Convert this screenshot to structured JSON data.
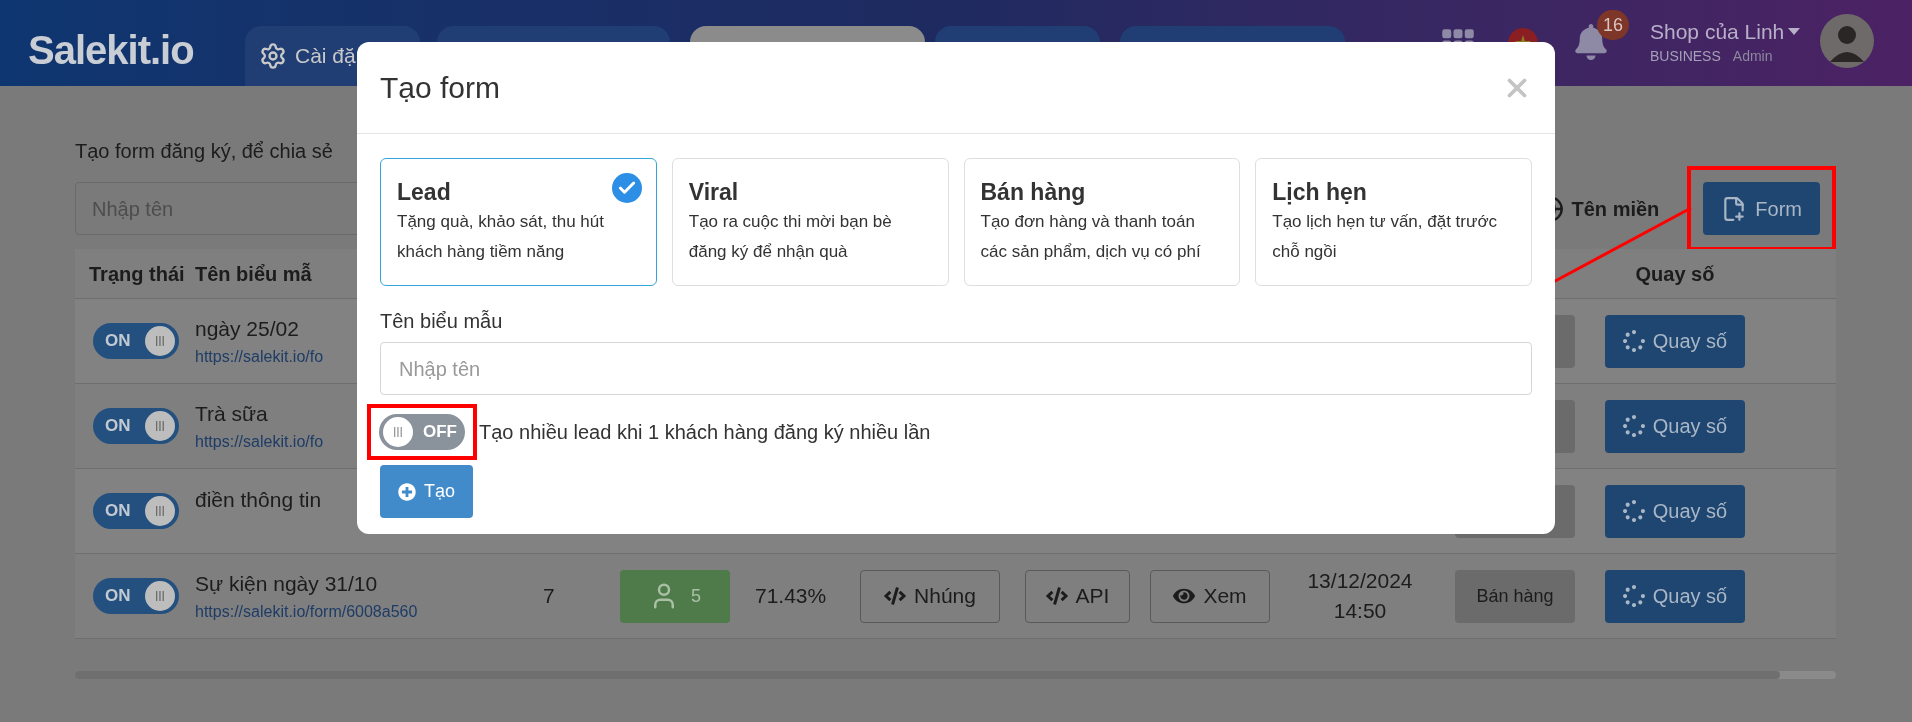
{
  "navbar": {
    "logo": "Salekit.io",
    "tabs": [
      {
        "label": "Cài đặ",
        "selected": false
      },
      {
        "selected": false
      },
      {
        "selected": true
      },
      {
        "selected": false
      },
      {
        "selected": false
      }
    ],
    "notifications": "16",
    "account": {
      "shop": "Shop của Linh",
      "plan": "BUSINESS",
      "role": "Admin"
    }
  },
  "page": {
    "intro": "Tạo form đăng ký, để chia sẻ",
    "search_placeholder": "Nhập tên",
    "buttons": [
      {
        "kind": "domain",
        "label": "Tên miền",
        "highlighted": false
      },
      {
        "kind": "form",
        "label": "Form",
        "highlighted": true
      }
    ]
  },
  "table": {
    "columns": {
      "status": "Trạng thái",
      "name": "Tên biểu mẫ",
      "draw": "Quay số"
    },
    "rows": [
      {
        "on": true,
        "status_label": "ON",
        "name": "ngày 25/02",
        "link": "https://salekit.io/fo",
        "draw_button": "Quay số"
      },
      {
        "on": true,
        "status_label": "ON",
        "name": "Trà sữa",
        "link": "https://salekit.io/fo",
        "draw_button": "Quay số"
      },
      {
        "on": true,
        "status_label": "ON",
        "name": "điền thông tin",
        "draw_button": "Quay số"
      },
      {
        "on": true,
        "status_label": "ON",
        "name": "Sự kiện ngày 31/10",
        "link": "https://salekit.io/form/6008a560",
        "count": "7",
        "leads": "5",
        "rate": "71.43%",
        "actions": [
          {
            "kind": "embed",
            "label": "Nhúng"
          },
          {
            "kind": "api",
            "label": "API"
          },
          {
            "kind": "view",
            "label": "Xem"
          }
        ],
        "date": "13/12/2024",
        "time": "14:50",
        "type": "Bán hàng",
        "draw_button": "Quay số"
      }
    ]
  },
  "modal": {
    "title": "Tạo form",
    "types": [
      {
        "title": "Lead",
        "description": "Tặng quà, khảo sát, thu hút khách hàng tiềm năng",
        "selected": true
      },
      {
        "title": "Viral",
        "description": "Tạo ra cuộc thi mời bạn bè đăng ký để nhận quà",
        "selected": false
      },
      {
        "title": "Bán hàng",
        "description": "Tạo đơn hàng và thanh toán các sản phẩm, dịch vụ có phí",
        "selected": false
      },
      {
        "title": "Lịch hẹn",
        "description": "Tạo lịch hẹn tư vấn, đặt trước chỗ ngồi",
        "selected": false
      }
    ],
    "name_label": "Tên biểu mẫu",
    "name_placeholder": "Nhập tên",
    "multi_lead": {
      "on": false,
      "state_label": "OFF",
      "label": "Tạo nhiều lead khi 1 khách hàng đăng ký nhiều lần",
      "highlighted": true
    },
    "submit": "Tạo"
  }
}
